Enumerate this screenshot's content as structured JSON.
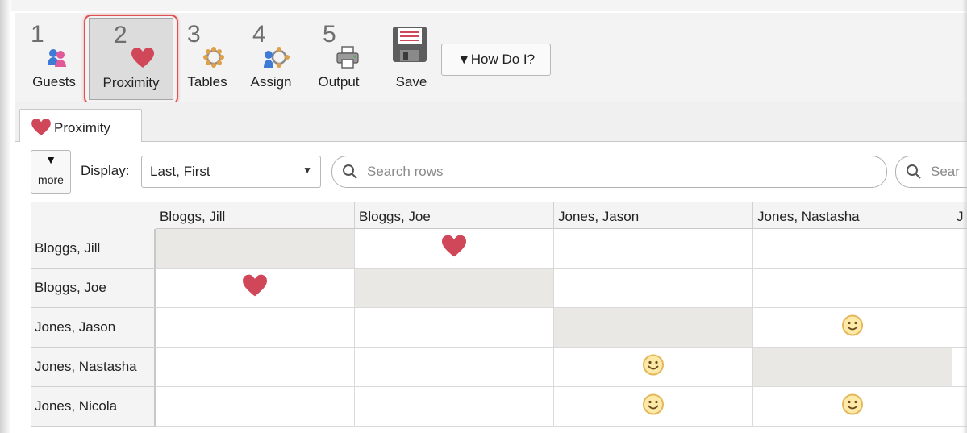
{
  "toolbar": {
    "buttons": [
      {
        "num": "1",
        "label": "Guests",
        "icon": "guests-icon"
      },
      {
        "num": "2",
        "label": "Proximity",
        "icon": "heart-icon",
        "active": true
      },
      {
        "num": "3",
        "label": "Tables",
        "icon": "table-ring-icon"
      },
      {
        "num": "4",
        "label": "Assign",
        "icon": "assign-icon"
      },
      {
        "num": "5",
        "label": "Output",
        "icon": "printer-icon"
      },
      {
        "num": "",
        "label": "Save",
        "icon": "floppy-disk-icon"
      }
    ],
    "how_do_i": "▼How Do I?"
  },
  "tab": {
    "label": "Proximity",
    "icon": "heart-icon"
  },
  "filter": {
    "more_arrow": "▼",
    "more_label": "more",
    "display_label": "Display:",
    "display_value": "Last, First",
    "search_rows_placeholder": "Search rows",
    "search_cols_placeholder": "Sear"
  },
  "grid": {
    "columns": [
      "Bloggs, Jill",
      "Bloggs, Joe",
      "Jones, Jason",
      "Jones, Nastasha",
      "J"
    ],
    "rows": [
      {
        "label": "Bloggs, Jill",
        "cells": [
          "diag",
          "heart",
          "",
          "",
          ""
        ]
      },
      {
        "label": "Bloggs, Joe",
        "cells": [
          "heart",
          "diag",
          "",
          "",
          ""
        ]
      },
      {
        "label": "Jones, Jason",
        "cells": [
          "",
          "",
          "diag",
          "smiley",
          ""
        ]
      },
      {
        "label": "Jones, Nastasha",
        "cells": [
          "",
          "",
          "smiley",
          "diag",
          ""
        ]
      },
      {
        "label": "Jones, Nicola",
        "cells": [
          "",
          "",
          "smiley",
          "smiley",
          ""
        ]
      }
    ]
  },
  "colors": {
    "heart": "#d0475a",
    "smiley": "#e4b85a",
    "highlight": "#e05050",
    "diagonal": "#e9e8e5"
  }
}
